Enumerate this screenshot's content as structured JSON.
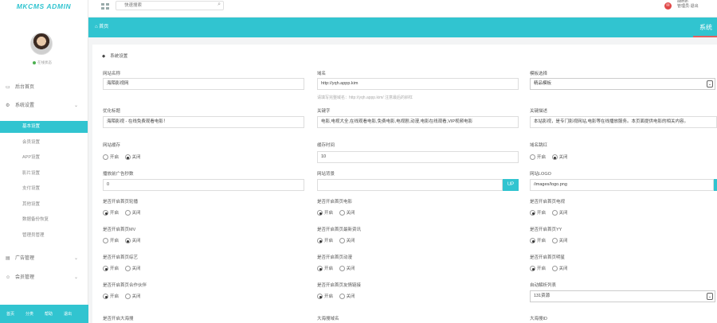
{
  "app": {
    "logo": "MKCMS ADMIN"
  },
  "user": {
    "status": "在线状态"
  },
  "search": {
    "placeholder": "快速搜索"
  },
  "topbar": {
    "user_line1": "admin",
    "user_line2": "管理员·退出"
  },
  "breadcrumb": {
    "home": "首页",
    "tab": "系统"
  },
  "sidebar": {
    "items": [
      {
        "label": "后台首页",
        "icon": "monitor-icon"
      },
      {
        "label": "系统设置",
        "icon": "settings-icon"
      }
    ],
    "sub_items": [
      "基本设置",
      "会员设置",
      "APP设置",
      "影片设置",
      "支付设置",
      "其他设置",
      "数据备份恢复",
      "管理员管理"
    ],
    "lower_items": [
      {
        "label": "广告管理",
        "icon": "ad-icon"
      },
      {
        "label": "会员管理",
        "icon": "users-icon"
      }
    ],
    "footer": [
      "首页",
      "分类",
      "帮助",
      "退出"
    ]
  },
  "panel": {
    "title": "系统设置"
  },
  "form": {
    "site_name": {
      "label": "网站名称",
      "value": "海陌影视网"
    },
    "domain": {
      "label": "域名",
      "value": "http://yqh.appp.kim",
      "hint": "请填写完整域名：http://yqh.appp.kim/    注意最后的斜杠"
    },
    "template": {
      "label": "模板选择",
      "value": "精品模板"
    },
    "seo_title": {
      "label": "优化标题",
      "value": "海陌影视 - 在线免费观看电影！"
    },
    "keywords": {
      "label": "关键字",
      "value": "电影,电视大全,在线观看电影,免费电影,电视剧,动漫,电影在线观看,VIP视频电影"
    },
    "description": {
      "label": "关键描述",
      "value": "本站影视，是专门影视网站,电影等在线播放服务。本页面提供电影的相关内容。"
    },
    "cache": {
      "label": "网站缓存",
      "on": "开启",
      "off": "关闭",
      "selected": "off"
    },
    "cache_time": {
      "label": "缓存时间",
      "value": "10"
    },
    "image_hotlink": {
      "label": "域名跳红",
      "on": "开启",
      "off": "关闭",
      "selected": "off"
    },
    "ad_seconds": {
      "label": "播放前广告秒数",
      "value": "0"
    },
    "watermark": {
      "label": "网站背景",
      "value": "",
      "up": "UP"
    },
    "logo": {
      "label": "网站LOGO",
      "value": "/images/logo.png"
    },
    "toggles": [
      {
        "label": "是否开启首页轮播",
        "on": "开启",
        "off": "关闭",
        "selected": "on"
      },
      {
        "label": "是否开启首页电影",
        "on": "开启",
        "off": "关闭",
        "selected": "on"
      },
      {
        "label": "是否开启首页电视",
        "on": "开启",
        "off": "关闭",
        "selected": "on"
      },
      {
        "label": "是否开启首页MV",
        "on": "开启",
        "off": "关闭",
        "selected": "off"
      },
      {
        "label": "是否开启首页最新资讯",
        "on": "开启",
        "off": "关闭",
        "selected": "on"
      },
      {
        "label": "是否开启首页YY",
        "on": "开启",
        "off": "关闭",
        "selected": "on"
      },
      {
        "label": "是否开启首页综艺",
        "on": "开启",
        "off": "关闭",
        "selected": "on"
      },
      {
        "label": "是否开启首页动漫",
        "on": "开启",
        "off": "关闭",
        "selected": "on"
      },
      {
        "label": "是否开启首页明星",
        "on": "开启",
        "off": "关闭",
        "selected": "on"
      },
      {
        "label": "是否开启首页合作伙伴",
        "on": "开启",
        "off": "关闭",
        "selected": "on"
      },
      {
        "label": "是否开启首页友情链接",
        "on": "开启",
        "off": "关闭",
        "selected": "on"
      }
    ],
    "auto_source": {
      "label": "自动解析列表",
      "value": "131资源"
    },
    "bottom_labels": [
      "是否开启大海搜",
      "大海搜域名",
      "大海搜ID"
    ]
  }
}
